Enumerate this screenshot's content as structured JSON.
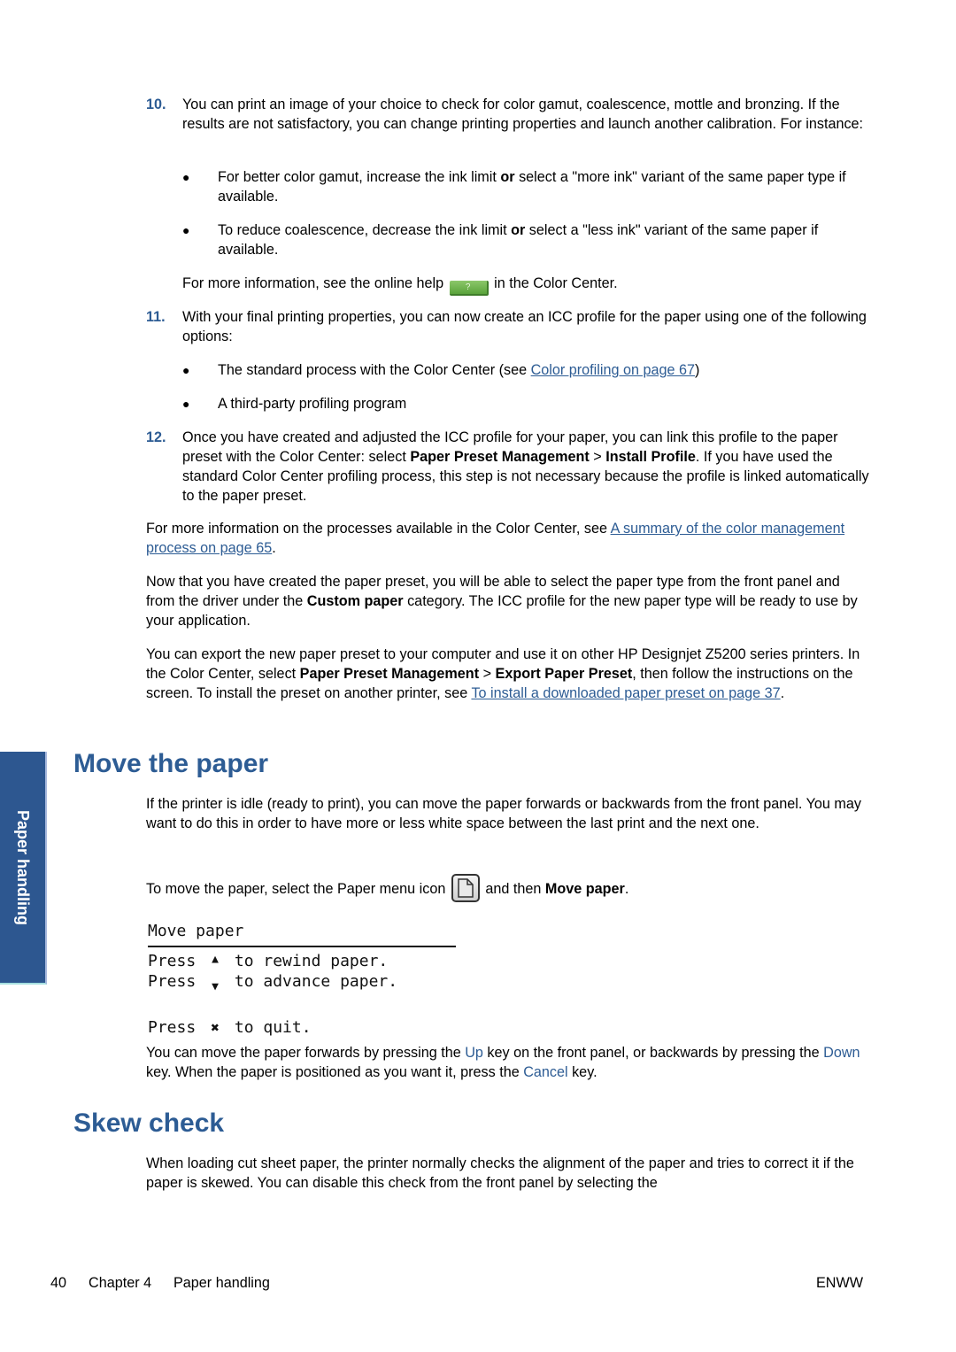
{
  "step10": {
    "number": "10.",
    "text": "You can print an image of your choice to check for color gamut, coalescence, mottle and bronzing. If the results are not satisfactory, you can change printing properties and launch another calibration. For instance:",
    "bullets": [
      {
        "pre": "For better color gamut, increase the ink limit ",
        "bold": "or",
        "post": " select a \"more ink\" variant of the same paper type if available."
      },
      {
        "pre": "To reduce coalescence, decrease the ink limit ",
        "bold": "or",
        "post": " select a \"less ink\" variant of the same paper if available."
      }
    ],
    "help_pre": "For more information, see the online help",
    "help_icon": "?",
    "help_post": "in the Color Center."
  },
  "step11": {
    "number": "11.",
    "text": "With your final printing properties, you can now create an ICC profile for the paper using one of the following options:",
    "bullet1_pre": "The standard process with the Color Center (see ",
    "bullet1_link": "Color profiling on page 67",
    "bullet1_post": ")",
    "bullet2": "A third-party profiling program"
  },
  "step12": {
    "number": "12.",
    "t1": "Once you have created and adjusted the ICC profile for your paper, you can link this profile to the paper preset with the Color Center: select ",
    "b1": "Paper Preset Management",
    "t2": " > ",
    "b2": "Install Profile",
    "t3": ". If you have used the standard Color Center profiling process, this step is not necessary because the profile is linked automatically to the paper preset."
  },
  "para_summary": {
    "pre": "For more information on the processes available in the Color Center, see ",
    "link": "A summary of the color management process on page 65",
    "post": "."
  },
  "para_custom": {
    "pre": "Now that you have created the paper preset, you will be able to select the paper type from the front panel and from the driver under the ",
    "bold": "Custom paper",
    "post": " category. The ICC profile for the new paper type will be ready to use by your application."
  },
  "para_export": {
    "t1": "You can export the new paper preset to your computer and use it on other HP Designjet Z5200 series printers. In the Color Center, select ",
    "b1": "Paper Preset Management",
    "t2": " > ",
    "b2": "Export Paper Preset",
    "t3": ", then follow the instructions on the screen. To install the preset on another printer, see ",
    "link": "To install a downloaded paper preset on page 37",
    "t4": "."
  },
  "side_tab": "Paper handling",
  "move_paper": {
    "heading": "Move the paper",
    "intro": "If the printer is idle (ready to print), you can move the paper forwards or backwards from the front panel. You may want to do this in order to have more or less white space between the last print and the next one.",
    "select_pre": "To move the paper, select the Paper menu icon",
    "select_mid": "and then ",
    "select_bold": "Move paper",
    "select_post": ".",
    "lcd": {
      "title": "Move paper",
      "line1_pre": "Press",
      "line1_sym": "▲",
      "line1_post": "to rewind paper.",
      "line2_pre": "Press",
      "line2_sym": "▼",
      "line2_post": "to advance paper.",
      "line3_pre": "Press",
      "line3_sym": "✖",
      "line3_post": "to quit."
    },
    "keys": {
      "t1": "You can move the paper forwards by pressing the ",
      "k1": "Up",
      "t2": " key on the front panel, or backwards by pressing the ",
      "k2": "Down",
      "t3": " key. When the paper is positioned as you want it, press the ",
      "k3": "Cancel",
      "t4": " key."
    }
  },
  "skew_check": {
    "heading": "Skew check",
    "text": "When loading cut sheet paper, the printer normally checks the alignment of the paper and tries to correct it if the paper is skewed. You can disable this check from the front panel by selecting the"
  },
  "footer": {
    "page_number": "40",
    "chapter": "Chapter 4",
    "chapter_title": "Paper handling",
    "right": "ENWW"
  }
}
